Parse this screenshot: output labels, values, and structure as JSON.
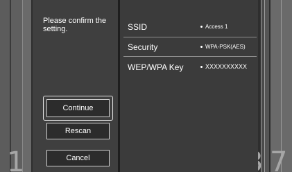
{
  "dialog": {
    "prompt": "Please confirm the setting."
  },
  "settings": [
    {
      "key": "SSID",
      "value": "Access 1"
    },
    {
      "key": "Security",
      "value": "WPA-PSK(AES)"
    },
    {
      "key": "WEP/WPA Key",
      "value": "XXXXXXXXXX"
    }
  ],
  "buttons": {
    "continue": "Continue",
    "rescan": "Rescan",
    "cancel": "Cancel"
  },
  "channel_numbers": {
    "left": "1",
    "right_a": "3",
    "right_b": "7"
  },
  "colors": {
    "panel": "#3b3b3b",
    "button": "#2c2c2c",
    "text": "#ffffff"
  }
}
